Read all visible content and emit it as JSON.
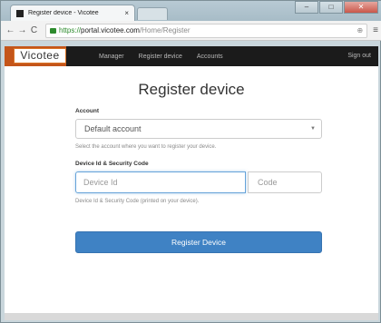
{
  "browser": {
    "tab_title": "Register device - Vicotee",
    "tab_close": "×",
    "win_min": "–",
    "win_max": "□",
    "win_close": "✕",
    "url_scheme": "https://",
    "url_host": "portal.vicotee.com",
    "url_path": "/Home/Register"
  },
  "navbar": {
    "brand": "Vicotee",
    "links": [
      "Manager",
      "Register device",
      "Accounts"
    ],
    "signout": "Sign out"
  },
  "page": {
    "title": "Register device",
    "account_label": "Account",
    "account_value": "Default account",
    "account_help": "Select the account where you want to register your device.",
    "device_label": "Device Id & Security Code",
    "device_placeholder": "Device Id",
    "code_placeholder": "Code",
    "device_help": "Device Id & Security Code (printed on your device).",
    "submit_label": "Register Device"
  },
  "colors": {
    "navbar_bg": "#1b1b1b",
    "brand_accent": "#c4551a",
    "primary_button": "#3f82c4"
  },
  "icons": {
    "back": "arrow-left-icon",
    "forward": "arrow-right-icon",
    "reload": "reload-icon",
    "lock": "lock-icon",
    "menu": "hamburger-menu-icon"
  }
}
